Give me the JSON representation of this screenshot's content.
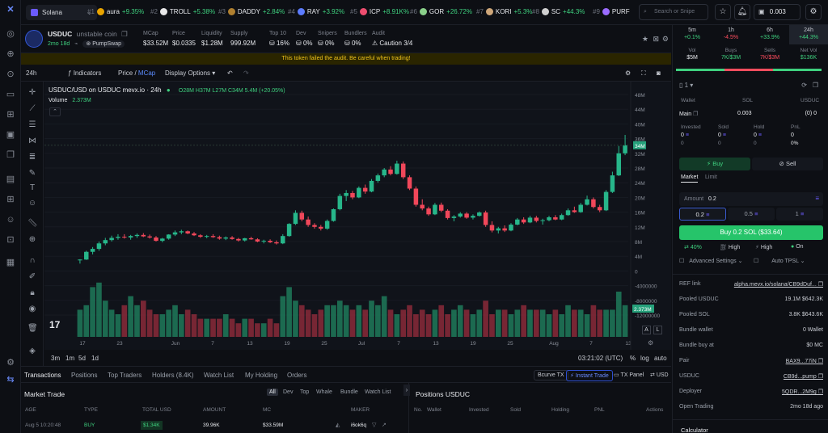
{
  "topbar": {
    "network": "Solana",
    "ticker": [
      {
        "rank": "#1",
        "name": "aura",
        "change": "+9.35%",
        "color": "#e9a400"
      },
      {
        "rank": "#2",
        "name": "TROLL",
        "change": "+5.38%",
        "color": "#e8e8e8"
      },
      {
        "rank": "#3",
        "name": "DADDY",
        "change": "+2.84%",
        "color": "#b08030"
      },
      {
        "rank": "#4",
        "name": "RAY",
        "change": "+3.92%",
        "color": "#5c7cff"
      },
      {
        "rank": "#5",
        "name": "ICP",
        "change": "+8.91K%",
        "color": "#ee4d6f"
      },
      {
        "rank": "#6",
        "name": "GOR",
        "change": "+26.72%",
        "color": "#8ad08a"
      },
      {
        "rank": "#7",
        "name": "KORI",
        "change": "+5.3%",
        "color": "#cfa77a"
      },
      {
        "rank": "#8",
        "name": "SC",
        "change": "+44.3%",
        "color": "#d0d0d0"
      },
      {
        "rank": "#9",
        "name": "PURF",
        "change": "",
        "color": "#9b6cff"
      }
    ],
    "search_placeholder": "Search or Snipe",
    "balance": "0.003"
  },
  "token": {
    "symbol": "USDUC",
    "subtitle": "unstable coin",
    "age": "2mo 18d",
    "dex": "PumpSwap",
    "stats": [
      {
        "label": "MCap",
        "value": "$33.52M",
        "cls": "w"
      },
      {
        "label": "Price",
        "value": "$0.0335",
        "cls": "w"
      },
      {
        "label": "Liquidity",
        "value": "$1.28M",
        "cls": "w"
      },
      {
        "label": "Supply",
        "value": "999.92M",
        "cls": "w"
      },
      {
        "label": "Top 10",
        "value": "16%",
        "cls": "r"
      },
      {
        "label": "Dev",
        "value": "0%",
        "cls": "g"
      },
      {
        "label": "Snipers",
        "value": "0%",
        "cls": "g"
      },
      {
        "label": "Bundlers",
        "value": "0%",
        "cls": "g"
      },
      {
        "label": "Audit",
        "value": "Caution 3/4",
        "cls": "y"
      }
    ],
    "warning": "This token failed the audit. Be careful when trading!"
  },
  "chart_toolbar": {
    "interval": "24h",
    "indicators": "Indicators",
    "price_label": "Price /",
    "mcap_label": "MCap",
    "display_options": "Display Options"
  },
  "chart_legend": {
    "pair": "USDUC/USD on USDUC mevx.io · 24h",
    "ohlc": "O28M H37M L27M C34M 5.4M (+20.05%)",
    "volume_label": "Volume",
    "volume_value": "2.373M"
  },
  "chart_data": {
    "type": "candlestick",
    "x_ticks": [
      "17",
      "23",
      "Jun",
      "7",
      "13",
      "19",
      "25",
      "Jul",
      "7",
      "13",
      "19",
      "25",
      "Aug",
      "7",
      "13"
    ],
    "y_ticks": [
      "48M",
      "44M",
      "40M",
      "36M",
      "32M",
      "28M",
      "24M",
      "20M",
      "16M",
      "12M",
      "8M",
      "4M",
      "0",
      "-4000000",
      "-8000000",
      "-12000000"
    ],
    "ylim": [
      -14000000,
      50000000
    ],
    "current_price_label": "34M",
    "current_volume_label": "2.373M",
    "candles": [
      [
        3,
        3.2,
        2,
        3.1
      ],
      [
        3.1,
        5.5,
        3,
        5.2
      ],
      [
        5.2,
        6.5,
        4.5,
        6
      ],
      [
        6,
        8,
        5.5,
        7.5
      ],
      [
        7.5,
        9,
        7,
        8.4
      ],
      [
        8.4,
        9.6,
        8,
        9
      ],
      [
        9,
        10,
        8.5,
        9.3
      ],
      [
        9.3,
        10,
        8.8,
        9.1
      ],
      [
        9.1,
        9.8,
        8.5,
        9.5
      ],
      [
        9.5,
        10.2,
        9,
        9.8
      ],
      [
        9.8,
        10.3,
        9.2,
        9.4
      ],
      [
        9.4,
        9.9,
        8.8,
        9.1
      ],
      [
        9.1,
        9.5,
        8,
        8.2
      ],
      [
        8.2,
        9,
        7.8,
        8.8
      ],
      [
        8.8,
        10,
        8.5,
        9.9
      ],
      [
        9.9,
        11,
        9.5,
        10.5
      ],
      [
        10.5,
        11.2,
        10,
        10.8
      ],
      [
        10.8,
        11,
        10,
        10.2
      ],
      [
        10.2,
        10.6,
        9.5,
        9.7
      ],
      [
        9.7,
        10,
        9,
        9.3
      ],
      [
        9.3,
        9.8,
        8.9,
        9.5
      ],
      [
        9.5,
        10,
        9,
        9.2
      ],
      [
        9.2,
        9.6,
        8.5,
        8.8
      ],
      [
        8.8,
        9.4,
        8.4,
        9.1
      ],
      [
        9.1,
        9.5,
        8.5,
        8.7
      ],
      [
        8.7,
        9,
        8,
        8.3
      ],
      [
        8.3,
        9,
        8,
        8.9
      ],
      [
        8.9,
        9.3,
        8.5,
        8.6
      ],
      [
        8.6,
        8.9,
        7.8,
        8
      ],
      [
        8,
        8.5,
        7.5,
        8.2
      ],
      [
        8.2,
        8.6,
        7.6,
        7.8
      ],
      [
        7.8,
        8.3,
        7.2,
        7.5
      ],
      [
        7.5,
        10,
        7.3,
        9.5
      ],
      [
        9.5,
        13,
        9.3,
        12.8
      ],
      [
        12.8,
        16.5,
        12.5,
        15.8
      ],
      [
        15.8,
        16.4,
        13.5,
        14
      ],
      [
        14,
        14.8,
        12,
        12.5
      ],
      [
        12.5,
        13,
        11.5,
        12
      ],
      [
        12,
        12.5,
        11,
        11.5
      ],
      [
        11.5,
        14,
        11.2,
        13.6
      ],
      [
        13.6,
        17,
        13.4,
        16.8
      ],
      [
        16.8,
        21,
        16.5,
        20.4
      ],
      [
        20.4,
        22,
        19,
        21.2
      ],
      [
        21.2,
        21.8,
        19.5,
        20
      ],
      [
        20,
        23,
        19.8,
        22.6
      ],
      [
        22.6,
        23.5,
        21,
        21.6
      ],
      [
        21.6,
        25,
        21.4,
        24.5
      ],
      [
        24.5,
        26.5,
        24,
        26
      ],
      [
        26,
        28,
        25.5,
        27.6
      ],
      [
        27.6,
        28.5,
        26,
        26.4
      ],
      [
        26.4,
        30,
        26.2,
        29.2
      ],
      [
        29.2,
        29.8,
        25,
        25.5
      ],
      [
        25.5,
        26,
        22,
        22.4
      ],
      [
        22.4,
        23,
        17.5,
        18
      ],
      [
        18,
        19.5,
        16.5,
        17
      ],
      [
        17,
        17.5,
        15,
        15.4
      ],
      [
        15.4,
        18.5,
        15.2,
        18
      ],
      [
        18,
        18.6,
        16,
        16.4
      ],
      [
        16.4,
        16.8,
        14,
        14.4
      ],
      [
        14.4,
        15.2,
        13.5,
        14.8
      ],
      [
        14.8,
        16,
        14.5,
        15.6
      ],
      [
        15.6,
        16,
        14.2,
        14.5
      ],
      [
        14.5,
        15.4,
        14,
        15
      ],
      [
        15,
        16.2,
        14.8,
        15.9
      ],
      [
        15.9,
        16.4,
        12,
        12.5
      ],
      [
        12.5,
        13.5,
        10.5,
        11
      ],
      [
        11,
        12,
        10.2,
        11.6
      ],
      [
        11.6,
        12.4,
        10.6,
        11
      ],
      [
        11,
        13,
        10.8,
        12.6
      ],
      [
        12.6,
        14.4,
        12.4,
        14
      ],
      [
        14,
        14.6,
        12.8,
        13.2
      ],
      [
        13.2,
        15,
        13,
        14.5
      ],
      [
        14.5,
        15,
        13.2,
        13.6
      ],
      [
        13.6,
        14.2,
        12.6,
        13.8
      ],
      [
        13.8,
        15,
        13.5,
        14.6
      ],
      [
        14.6,
        15.2,
        13.8,
        14
      ],
      [
        14,
        15.6,
        13.8,
        15.2
      ],
      [
        15.2,
        17,
        15,
        16.5
      ],
      [
        16.5,
        17.5,
        15.8,
        16
      ],
      [
        16,
        18.5,
        15.8,
        18
      ],
      [
        18,
        20.5,
        17.8,
        19.5
      ],
      [
        19.5,
        20,
        17,
        17.4
      ],
      [
        17.4,
        18,
        16,
        16.5
      ],
      [
        16.5,
        22,
        16.3,
        21.5
      ],
      [
        21.5,
        27,
        21.2,
        26
      ],
      [
        26,
        34,
        25.8,
        32
      ],
      [
        32,
        37,
        31.5,
        34.2
      ]
    ],
    "volumes": [
      6,
      7,
      11,
      12,
      8,
      6,
      5,
      7,
      9,
      7,
      8,
      6,
      5,
      5,
      6,
      7,
      5,
      6,
      5,
      4,
      4,
      4,
      4,
      5,
      4,
      3,
      4,
      4,
      3,
      3,
      4,
      3,
      9,
      11,
      8,
      7,
      6,
      5,
      6,
      7,
      7,
      8,
      7,
      6,
      7,
      6,
      8,
      7,
      9,
      6,
      5,
      6,
      7,
      5,
      6,
      5,
      6,
      7,
      5,
      6,
      7,
      6,
      5,
      6,
      8,
      5,
      6,
      6,
      5,
      6,
      7,
      6,
      6,
      6,
      5,
      6,
      5,
      7,
      6,
      6,
      5,
      7,
      6,
      6,
      6,
      10,
      7
    ]
  },
  "chart_footer": {
    "ranges": [
      "3m",
      "1m",
      "5d",
      "1d"
    ],
    "time": "03:21:02 (UTC)",
    "pct": "%",
    "log": "log",
    "auto": "auto"
  },
  "bottom_tabs": [
    "Transactions",
    "Positions",
    "Top Traders",
    "Holders (8.4K)",
    "Watch List",
    "My Holding",
    "Orders"
  ],
  "bottom_right": {
    "bcurve": "Bcurve TX",
    "instant": "Instant Trade",
    "txpanel": "TX Panel",
    "currency": "USD"
  },
  "market_trade": {
    "title": "Market Trade",
    "filters": [
      "All",
      "Dev",
      "Top",
      "Whale",
      "Bundle",
      "Watch List"
    ],
    "columns": [
      "AGE",
      "TYPE",
      "TOTAL USD",
      "AMOUNT",
      "MC",
      "MAKER"
    ],
    "rows": [
      {
        "age": "Aug 5 10:20:48",
        "type": "BUY",
        "total": "$1.34K",
        "amount": "39.96K",
        "mc": "$33.59M",
        "maker": "i6ok6q"
      }
    ]
  },
  "positions": {
    "title": "Positions USDUC",
    "columns": [
      "No.",
      "Wallet",
      "Invested",
      "Sold",
      "Holding",
      "PNL",
      "Actions"
    ]
  },
  "right_panel": {
    "timeframes": [
      {
        "label": "5m",
        "value": "+0.1%",
        "cls": "g"
      },
      {
        "label": "1h",
        "value": "-4.5%",
        "cls": "r"
      },
      {
        "label": "6h",
        "value": "+33.9%",
        "cls": "g"
      },
      {
        "label": "24h",
        "value": "+44.3%",
        "cls": "g"
      }
    ],
    "volstats": [
      {
        "label": "Vol",
        "value": "$5M",
        "cls": "w"
      },
      {
        "label": "Buys",
        "value": "7K/$3M",
        "cls": "g"
      },
      {
        "label": "Sells",
        "value": "7K/$3M",
        "cls": "r"
      },
      {
        "label": "Net Vol",
        "value": "$136K",
        "cls": "g"
      }
    ],
    "wallet_header": [
      "Wallet",
      "SOL",
      "USDUC"
    ],
    "wallet_row": {
      "name": "Main",
      "sol": "0.003",
      "usduc": "0"
    },
    "holdings_header": [
      "Invested",
      "Sold",
      "Hold",
      "PnL"
    ],
    "holdings_values": [
      "0",
      "0",
      "0",
      "0"
    ],
    "holdings_sub": [
      "0",
      "0",
      "0",
      "0%"
    ],
    "buy_label": "Buy",
    "sell_label": "Sell",
    "order_tabs": [
      "Market",
      "Limit"
    ],
    "amount_label": "Amount",
    "amount_value": "0.2",
    "presets": [
      "0.2",
      "0.5",
      "1"
    ],
    "buy_button": "Buy 0.2 SOL ($33.64)",
    "settings": [
      {
        "label": "40%",
        "cls": "g"
      },
      {
        "label": "High",
        "cls": "mut"
      },
      {
        "label": "High",
        "cls": "mut"
      },
      {
        "label": "On",
        "cls": "mut"
      }
    ],
    "advanced": "Advanced Settings",
    "autotpsl": "Auto TPSL",
    "info": [
      {
        "key": "REF link",
        "val": "alpha.mevx.io/solana/CB9dDuf..."
      },
      {
        "key": "Pooled USDUC",
        "val": "19.1M   $642.3K"
      },
      {
        "key": "Pooled SOL",
        "val": "3.8K   $643.6K"
      },
      {
        "key": "Bundle wallet",
        "val": "0 Wallet"
      },
      {
        "key": "Bundle buy at",
        "val": "$0 MC"
      },
      {
        "key": "Pair",
        "val": "BAX9...77iN"
      },
      {
        "key": "USDUC",
        "val": "CB9d...pump"
      },
      {
        "key": "Deployer",
        "val": "5QDR...2M9g"
      },
      {
        "key": "Open Trading",
        "val": "2mo 18d ago"
      }
    ],
    "calculator": "Calculator"
  }
}
